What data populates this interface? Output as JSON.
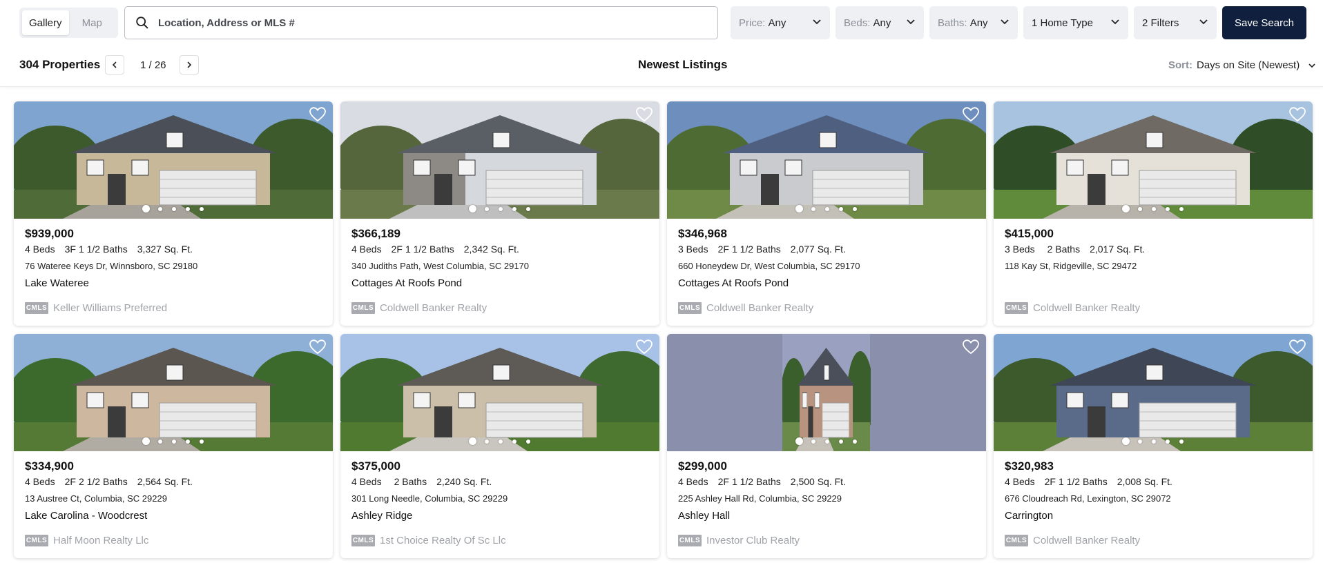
{
  "view_toggle": {
    "gallery": "Gallery",
    "map": "Map"
  },
  "search": {
    "placeholder": "Location, Address or MLS #"
  },
  "filters": {
    "price_label": "Price:",
    "price_value": "Any",
    "beds_label": "Beds:",
    "beds_value": "Any",
    "baths_label": "Baths:",
    "baths_value": "Any",
    "home_type": "1 Home Type",
    "more_filters": "2 Filters"
  },
  "save_search": "Save Search",
  "results": {
    "count": "304 Properties",
    "page": "1 / 26",
    "title": "Newest Listings",
    "sort_label": "Sort:",
    "sort_value": "Days on Site (Newest)"
  },
  "mls_badge": "CMLS",
  "listings": [
    {
      "price": "$939,000",
      "beds": "4 Beds",
      "baths_prefix": "3F",
      "baths_text": "1 1/2 Baths",
      "sqft": "3,327 Sq. Ft.",
      "address": "76 Wateree Keys Dr, Winnsboro, SC 29180",
      "subdivision": "Lake Wateree",
      "broker": "Keller Williams Preferred"
    },
    {
      "price": "$366,189",
      "beds": "4 Beds",
      "baths_prefix": "2F",
      "baths_text": "1 1/2 Baths",
      "sqft": "2,342 Sq. Ft.",
      "address": "340 Judiths Path, West Columbia, SC 29170",
      "subdivision": "Cottages At Roofs Pond",
      "broker": "Coldwell Banker Realty"
    },
    {
      "price": "$346,968",
      "beds": "3 Beds",
      "baths_prefix": "2F",
      "baths_text": "1 1/2 Baths",
      "sqft": "2,077 Sq. Ft.",
      "address": "660 Honeydew Dr, West Columbia, SC 29170",
      "subdivision": "Cottages At Roofs Pond",
      "broker": "Coldwell Banker Realty"
    },
    {
      "price": "$415,000",
      "beds": "3 Beds",
      "baths_prefix": "",
      "baths_text": "2 Baths",
      "sqft": "2,017 Sq. Ft.",
      "address": "118 Kay St, Ridgeville, SC 29472",
      "subdivision": "",
      "broker": "Coldwell Banker Realty"
    },
    {
      "price": "$334,900",
      "beds": "4 Beds",
      "baths_prefix": "2F",
      "baths_text": "2 1/2 Baths",
      "sqft": "2,564 Sq. Ft.",
      "address": "13 Austree Ct, Columbia, SC 29229",
      "subdivision": "Lake Carolina - Woodcrest",
      "broker": "Half Moon Realty Llc"
    },
    {
      "price": "$375,000",
      "beds": "4 Beds",
      "baths_prefix": "",
      "baths_text": "2 Baths",
      "sqft": "2,240 Sq. Ft.",
      "address": "301 Long Needle, Columbia, SC 29229",
      "subdivision": "Ashley Ridge",
      "broker": "1st Choice Realty Of Sc Llc"
    },
    {
      "price": "$299,000",
      "beds": "4 Beds",
      "baths_prefix": "2F",
      "baths_text": "1 1/2 Baths",
      "sqft": "2,500 Sq. Ft.",
      "address": "225 Ashley Hall Rd, Columbia, SC 29229",
      "subdivision": "Ashley Hall",
      "broker": "Investor Club Realty"
    },
    {
      "price": "$320,983",
      "beds": "4 Beds",
      "baths_prefix": "2F",
      "baths_text": "1 1/2 Baths",
      "sqft": "2,008 Sq. Ft.",
      "address": "676 Cloudreach Rd, Lexington, SC 29072",
      "subdivision": "Carrington",
      "broker": "Coldwell Banker Realty"
    }
  ],
  "colors": {
    "save_button": "#0f1f3d",
    "filter_bg": "#eef0f4",
    "muted": "#8a8f98"
  },
  "icons": {
    "search": "search-icon",
    "heart": "heart-icon",
    "chevron": "chevron-down-icon",
    "prev": "chevron-left-icon",
    "next": "chevron-right-icon"
  }
}
